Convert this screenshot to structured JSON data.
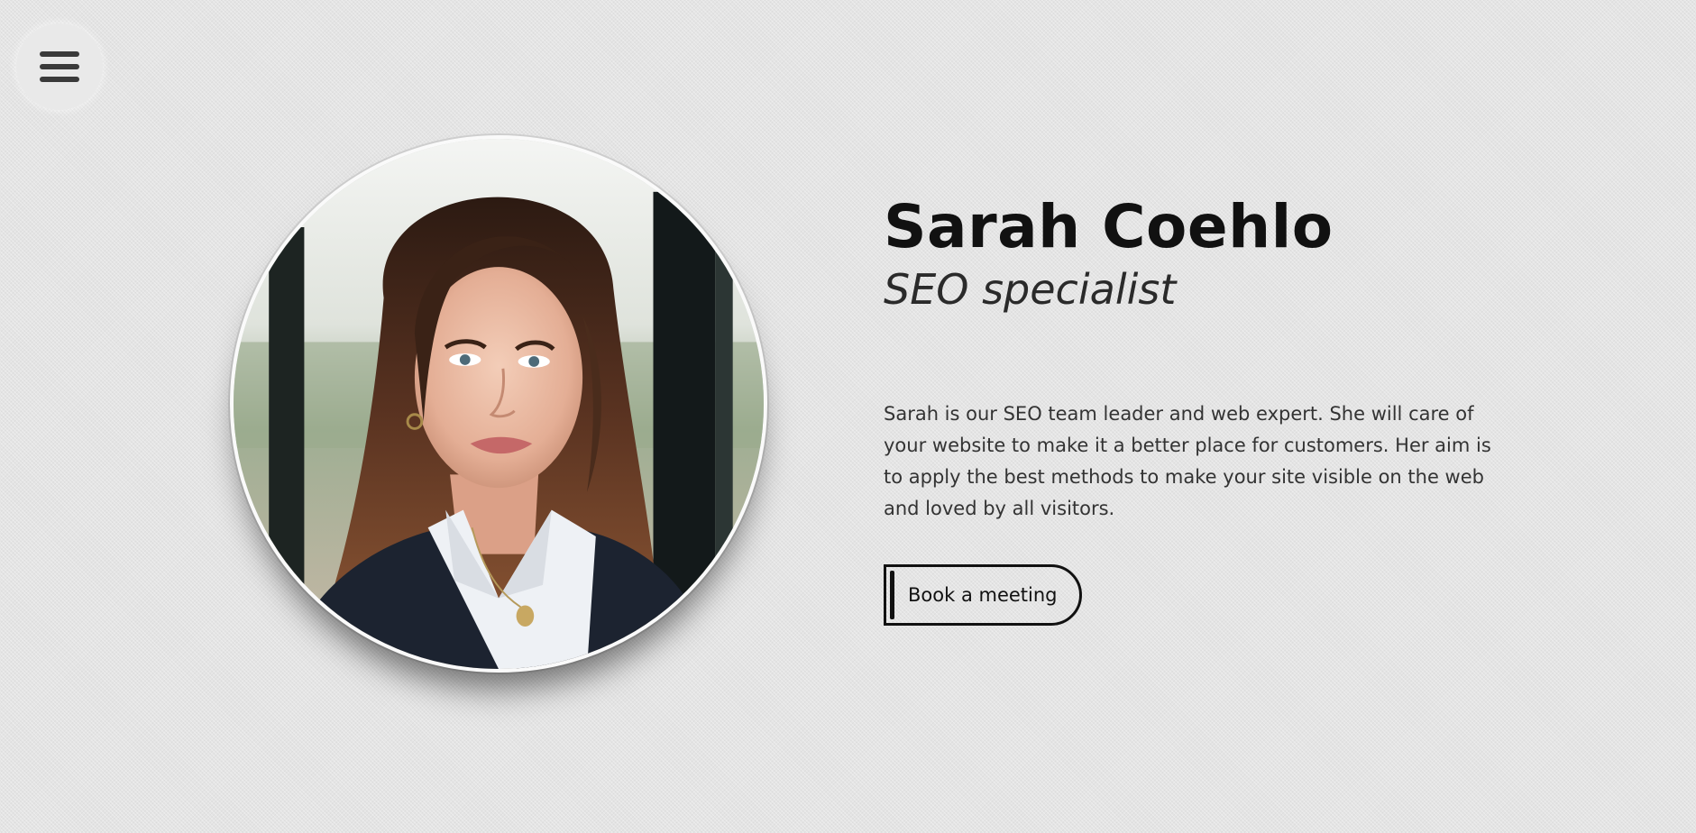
{
  "menu": {
    "icon": "hamburger-menu-icon"
  },
  "profile": {
    "photo_alt": "Sarah Coehlo",
    "name": "Sarah Coehlo",
    "role": "SEO specialist",
    "bio": "Sarah is our SEO team leader and web expert. She will care of your website to make it a better place for customers. Her aim is to apply the best methods to make your site visible on the web and loved by all visitors.",
    "cta_label": "Book a meeting"
  },
  "colors": {
    "background": "#e4e4e4",
    "text": "#1a1a1a",
    "button_border": "#111111"
  }
}
